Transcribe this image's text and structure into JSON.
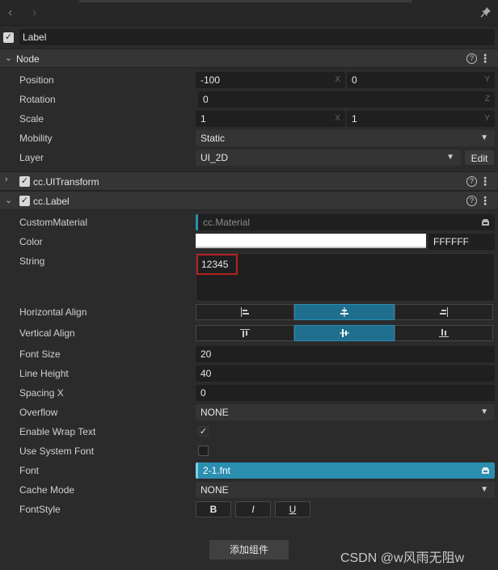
{
  "node_label": {
    "enabled": true,
    "name": "Label"
  },
  "node_section": {
    "title": "Node"
  },
  "node_props": {
    "position": {
      "label": "Position",
      "x": "-100",
      "y": "0",
      "x_axis": "X",
      "y_axis": "Y"
    },
    "rotation": {
      "label": "Rotation",
      "z": "0",
      "z_axis": "Z"
    },
    "scale": {
      "label": "Scale",
      "x": "1",
      "y": "1",
      "x_axis": "X",
      "y_axis": "Y"
    },
    "mobility": {
      "label": "Mobility",
      "value": "Static"
    },
    "layer": {
      "label": "Layer",
      "value": "UI_2D",
      "edit_label": "Edit"
    }
  },
  "uitransform_section": {
    "title": "cc.UITransform",
    "enabled": true,
    "expanded": false
  },
  "label_section": {
    "title": "cc.Label",
    "enabled": true,
    "expanded": true
  },
  "label_props": {
    "custom_material": {
      "label": "CustomMaterial",
      "placeholder": "cc.Material"
    },
    "color": {
      "label": "Color",
      "hex": "FFFFFF",
      "swatch": "#ffffff"
    },
    "string": {
      "label": "String",
      "value": "12345"
    },
    "horizontal_align": {
      "label": "Horizontal Align",
      "selected_index": 1
    },
    "vertical_align": {
      "label": "Vertical Align",
      "selected_index": 1
    },
    "font_size": {
      "label": "Font Size",
      "value": "20"
    },
    "line_height": {
      "label": "Line Height",
      "value": "40"
    },
    "spacing_x": {
      "label": "Spacing X",
      "value": "0"
    },
    "overflow": {
      "label": "Overflow",
      "value": "NONE"
    },
    "enable_wrap_text": {
      "label": "Enable Wrap Text",
      "checked": true
    },
    "use_system_font": {
      "label": "Use System Font",
      "checked": false
    },
    "font": {
      "label": "Font",
      "value": "2-1.fnt"
    },
    "cache_mode": {
      "label": "Cache Mode",
      "value": "NONE"
    },
    "font_style": {
      "label": "FontStyle",
      "bold": "B",
      "italic": "I",
      "underline": "U"
    }
  },
  "add_component": {
    "label": "添加组件"
  },
  "watermark": "CSDN @w风雨无阻w",
  "colors": {
    "accent": "#1f6e8e",
    "font_field": "#2b8fb0",
    "highlight_box": "#b32121"
  }
}
